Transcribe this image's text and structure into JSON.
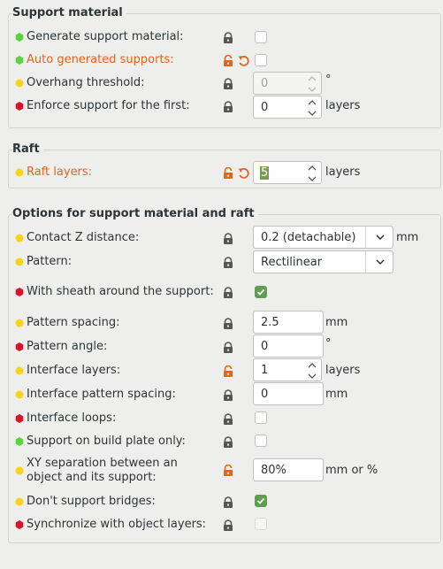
{
  "groups": {
    "support": {
      "title": "Support material",
      "generate_label": "Generate support material:",
      "auto_label": "Auto generated supports:",
      "overhang_label": "Overhang threshold:",
      "overhang_value": "0",
      "overhang_unit": "°",
      "enforce_label": "Enforce support for the first:",
      "enforce_value": "0",
      "enforce_unit": "layers"
    },
    "raft": {
      "title": "Raft",
      "layers_label": "Raft layers:",
      "layers_value": "5",
      "layers_unit": "layers"
    },
    "options": {
      "title": "Options for support material and raft",
      "contact_z_label": "Contact Z distance:",
      "contact_z_value": "0.2 (detachable)",
      "contact_z_unit": "mm",
      "pattern_label": "Pattern:",
      "pattern_value": "Rectilinear",
      "sheath_label": "With sheath around the support:",
      "spacing_label": "Pattern spacing:",
      "spacing_value": "2.5",
      "spacing_unit": "mm",
      "angle_label": "Pattern angle:",
      "angle_value": "0",
      "angle_unit": "°",
      "interface_layers_label": "Interface layers:",
      "interface_layers_value": "1",
      "interface_layers_unit": "layers",
      "interface_spacing_label": "Interface pattern spacing:",
      "interface_spacing_value": "0",
      "interface_spacing_unit": "mm",
      "interface_loops_label": "Interface loops:",
      "buildplate_label": "Support on build plate only:",
      "xy_sep_label_line1": "XY separation between an",
      "xy_sep_label_line2": "object and its support:",
      "xy_sep_value": "80%",
      "xy_sep_unit": "mm or %",
      "bridges_label": "Don't support bridges:",
      "sync_label": "Synchronize with object layers:"
    }
  },
  "colors": {
    "green_bullet": "#5cd33e",
    "yellow_bullet": "#f8d31b",
    "red_bullet": "#d8132a",
    "modified_orange": "#e3641e",
    "check_green": "#5e9e4e"
  },
  "icons": {
    "lock_closed": "lock-icon",
    "lock_open": "unlock-icon",
    "undo": "undo-arrow-icon",
    "spin_arrows": "spin-arrows-icon",
    "dropdown": "chevron-down-icon"
  }
}
